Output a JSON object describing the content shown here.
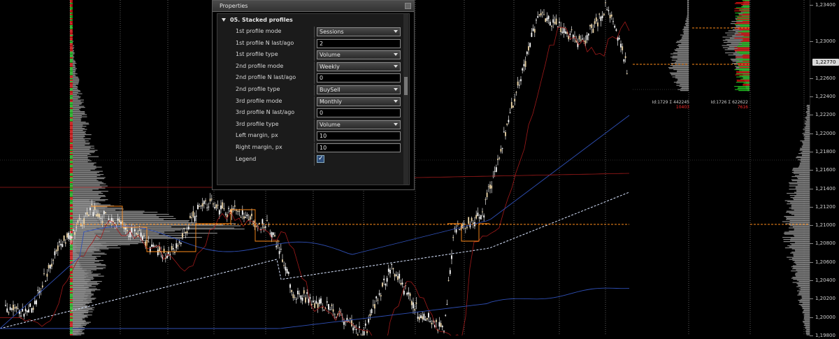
{
  "properties_panel": {
    "title": "Properties",
    "section": "05. Stacked profiles",
    "rows": [
      {
        "label": "1st profile mode",
        "value": "Sessions",
        "type": "select"
      },
      {
        "label": "1st profile N last/ago",
        "value": "2",
        "type": "input"
      },
      {
        "label": "1st profile type",
        "value": "Volume",
        "type": "select"
      },
      {
        "label": "2nd profile mode",
        "value": "Weekly",
        "type": "select"
      },
      {
        "label": "2nd profile N last/ago",
        "value": "0",
        "type": "input"
      },
      {
        "label": "2nd profile type",
        "value": "BuySell",
        "type": "select"
      },
      {
        "label": "3rd profile mode",
        "value": "Monthly",
        "type": "select"
      },
      {
        "label": "3rd profile N last/ago",
        "value": "0",
        "type": "input"
      },
      {
        "label": "3rd profile type",
        "value": "Volume",
        "type": "select"
      },
      {
        "label": "Left margin, px",
        "value": "10",
        "type": "input"
      },
      {
        "label": "Right margin, px",
        "value": "10",
        "type": "input"
      },
      {
        "label": "Legend",
        "value": "checked",
        "type": "checkbox"
      }
    ]
  },
  "price_axis": {
    "labels": [
      "1,23400",
      "1,23000",
      "1,22600",
      "1,22400",
      "1,22200",
      "1,22000",
      "1,21800",
      "1,21600",
      "1,21400",
      "1,21200",
      "1,21000",
      "1,20800",
      "1,20600",
      "1,20400",
      "1,20200",
      "1,20000",
      "1,19800"
    ],
    "current_price": "1,22770",
    "min": 1.198,
    "max": 1.2345
  },
  "profile_stats": [
    {
      "line1": "Id:1729 Σ 442245",
      "line2": "10403"
    },
    {
      "line1": "Id:1726 Σ 622622",
      "line2": "7616"
    }
  ],
  "colors": {
    "candle": "#e8e8e8",
    "ma_red": "#a11a1a",
    "ma_blue": "#2f4fb5",
    "ma_dashed": "#d8e4ff",
    "poc": "#ff8c1a",
    "buy": "#22c322",
    "sell": "#e01010",
    "profile_gray": "#9a9a9a",
    "grid": "#9a9a9a"
  }
}
